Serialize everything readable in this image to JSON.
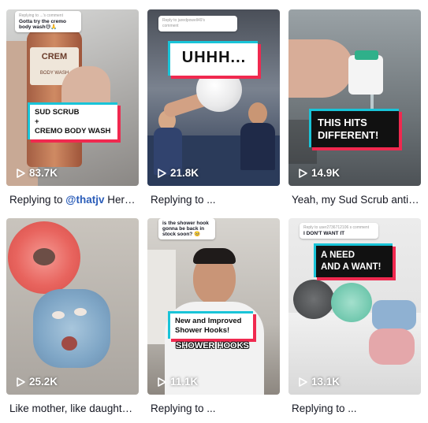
{
  "videos": [
    {
      "views": "83.7K",
      "caption_prefix": "Replying to ",
      "caption_mention": "@thatjv",
      "caption_suffix": " Here…",
      "reply_label": "Replying to ...'s comment",
      "reply_text": "Gotta try the cremo body wash😅🙏",
      "overlay_line1": "SUD SCRUB",
      "overlay_line2": "+",
      "overlay_line3": "CREMO BODY WASH",
      "bottle_brand": "CREM",
      "bottle_text": "BODY WASH"
    },
    {
      "views": "21.8K",
      "caption": "Replying to ...",
      "reply_label": "Reply to jaredpowell49's",
      "reply_text": "comment",
      "overlay": "UHHH..."
    },
    {
      "views": "14.9K",
      "caption": "Yeah, my Sud Scrub anti…",
      "overlay_line1": "THIS HITS",
      "overlay_line2": "DIFFERENT!"
    },
    {
      "views": "25.2K",
      "caption": "Like mother, like daughter…"
    },
    {
      "views": "11.1K",
      "caption": "Replying to ...",
      "reply_text": "is the shower hook gonna be back in stock soon? 🥺",
      "overlay_line1": "New and Improved",
      "overlay_line2": "Shower Hooks!",
      "subtitle": "SHOWER HOOKS"
    },
    {
      "views": "13.1K",
      "caption": "Replying to ...",
      "reply_label": "Reply to user2736712106 s comment",
      "reply_text": "I DON'T WANT IT",
      "overlay_line1": "A NEED",
      "overlay_line2": "AND A WANT!"
    }
  ],
  "colors": {
    "accent_cyan": "#19c4d8",
    "accent_red": "#f0294f",
    "mention": "#2b5db9",
    "text": "#161823"
  },
  "icons": {
    "views": "play-icon"
  }
}
